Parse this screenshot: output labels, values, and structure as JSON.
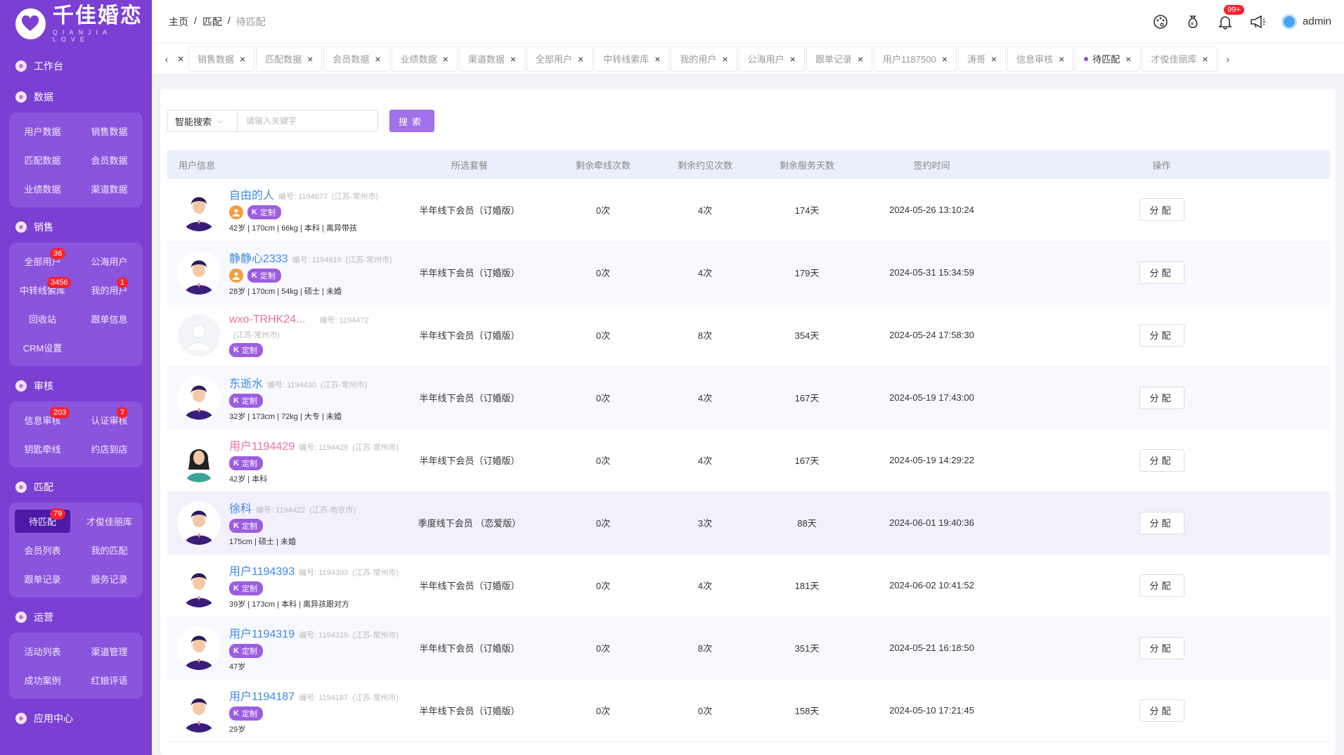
{
  "brand": {
    "title": "千佳婚恋",
    "subtitle": "QIANJIA LOVE"
  },
  "sidebar": {
    "workbench": "工作台",
    "groups": [
      {
        "label": "数据",
        "items": [
          {
            "label": "用户数据"
          },
          {
            "label": "销售数据"
          },
          {
            "label": "匹配数据"
          },
          {
            "label": "会员数据"
          },
          {
            "label": "业绩数据"
          },
          {
            "label": "渠道数据"
          }
        ]
      },
      {
        "label": "销售",
        "items": [
          {
            "label": "全部用户",
            "badge": "36"
          },
          {
            "label": "公海用户"
          },
          {
            "label": "中转线索库",
            "badge": "3456"
          },
          {
            "label": "我的用户",
            "badge": "1"
          },
          {
            "label": "回收站"
          },
          {
            "label": "跟单信息"
          },
          {
            "label": "CRM设置"
          }
        ]
      },
      {
        "label": "审核",
        "items": [
          {
            "label": "信息审核",
            "badge": "203"
          },
          {
            "label": "认证审核",
            "badge": "7"
          },
          {
            "label": "钥匙牵线"
          },
          {
            "label": "约店到店"
          }
        ]
      },
      {
        "label": "匹配",
        "items": [
          {
            "label": "待匹配",
            "badge": "79",
            "active": true
          },
          {
            "label": "才俊佳丽库"
          },
          {
            "label": "会员列表"
          },
          {
            "label": "我的匹配"
          },
          {
            "label": "跟单记录"
          },
          {
            "label": "服务记录"
          }
        ]
      },
      {
        "label": "运营",
        "items": [
          {
            "label": "活动列表"
          },
          {
            "label": "渠道管理"
          },
          {
            "label": "成功案例"
          },
          {
            "label": "红娘评语"
          }
        ]
      }
    ],
    "app_center": "应用中心"
  },
  "header": {
    "breadcrumb": [
      "主页",
      "匹配",
      "待匹配"
    ],
    "sep": "/",
    "notif_badge": "99+",
    "user": "admin"
  },
  "tabs": [
    "销售数据",
    "匹配数据",
    "会员数据",
    "业绩数据",
    "渠道数据",
    "全部用户",
    "中转线索库",
    "我的用户",
    "公海用户",
    "跟单记录",
    "用户1187500",
    "涛哥",
    "信息审核",
    "待匹配",
    "才俊佳丽库"
  ],
  "active_tab": "待匹配",
  "search": {
    "select": "智能搜索",
    "placeholder": "请输入关键字",
    "button": "搜索"
  },
  "columns": [
    "用户信息",
    "所选套餐",
    "剩余牵线次数",
    "剩余约见次数",
    "剩余服务天数",
    "签约时间",
    "操作"
  ],
  "rows": [
    {
      "name": "自由的人",
      "id": "编号: 1194677",
      "region": "(江苏-常州市)",
      "gold": true,
      "tag": "定制",
      "attrs": "42岁 | 170cm | 66kg | 本科 | 离异带孩",
      "avatar": "male",
      "package": "半年线下会员（订婚版）",
      "qx": "0次",
      "yj": "4次",
      "days": "174天",
      "time": "2024-05-26 13:10:24",
      "action": "分配"
    },
    {
      "name": "静静心2333",
      "id": "编号: 1194616",
      "region": "(江苏-常州市)",
      "gold": true,
      "tag": "定制",
      "attrs": "28岁 | 170cm | 54kg | 硕士 | 未婚",
      "avatar": "male",
      "package": "半年线下会员（订婚版）",
      "qx": "0次",
      "yj": "4次",
      "days": "179天",
      "time": "2024-05-31 15:34:59",
      "action": "分配"
    },
    {
      "name": "wxo-TRHK24...",
      "id": "编号: 1194472",
      "region": "(江苏-常州市)",
      "pink": true,
      "tag": "定制",
      "attrs": "",
      "avatar": "blank",
      "package": "半年线下会员（订婚版）",
      "qx": "0次",
      "yj": "8次",
      "days": "354天",
      "time": "2024-05-24 17:58:30",
      "action": "分配"
    },
    {
      "name": "东逝水",
      "id": "编号: 1194430",
      "region": "(江苏-常州市)",
      "tag": "定制",
      "attrs": "32岁 | 173cm | 72kg | 大专 | 未婚",
      "avatar": "male",
      "package": "半年线下会员（订婚版）",
      "qx": "0次",
      "yj": "4次",
      "days": "167天",
      "time": "2024-05-19 17:43:00",
      "action": "分配"
    },
    {
      "name": "用户1194429",
      "id": "编号: 1194429",
      "region": "(江苏-常州市)",
      "pink": true,
      "tag": "定制",
      "attrs": "42岁 | 本科",
      "avatar": "female",
      "package": "半年线下会员（订婚版）",
      "qx": "0次",
      "yj": "4次",
      "days": "167天",
      "time": "2024-05-19 14:29:22",
      "action": "分配"
    },
    {
      "name": "徐科",
      "id": "编号: 1194422",
      "region": "(江苏-南京市)",
      "tag": "定制",
      "attrs": "175cm | 硕士 | 未婚",
      "avatar": "male",
      "highlight": true,
      "package": "季度线下会员 （恋爱版）",
      "qx": "0次",
      "yj": "3次",
      "days": "88天",
      "time": "2024-06-01 19:40:36",
      "action": "分配"
    },
    {
      "name": "用户1194393",
      "id": "编号: 1194393",
      "region": "(江苏-常州市)",
      "tag": "定制",
      "attrs": "39岁 | 173cm | 本科 | 离异孩跟对方",
      "avatar": "male",
      "package": "半年线下会员（订婚版）",
      "qx": "0次",
      "yj": "4次",
      "days": "181天",
      "time": "2024-06-02 10:41:52",
      "action": "分配"
    },
    {
      "name": "用户1194319",
      "id": "编号: 1194319",
      "region": "(江苏-常州市)",
      "tag": "定制",
      "attrs": "47岁",
      "avatar": "male",
      "package": "半年线下会员（订婚版）",
      "qx": "0次",
      "yj": "8次",
      "days": "351天",
      "time": "2024-05-21 16:18:50",
      "action": "分配"
    },
    {
      "name": "用户1194187",
      "id": "编号: 1194187",
      "region": "(江苏-常州市)",
      "tag": "定制",
      "attrs": "29岁",
      "avatar": "male",
      "package": "半年线下会员（订婚版）",
      "qx": "0次",
      "yj": "0次",
      "days": "158天",
      "time": "2024-05-10 17:21:45",
      "action": "分配"
    }
  ],
  "colors": {
    "sidebar": "#7b3fd4",
    "accent": "#a270ea",
    "link": "#3d8ae6",
    "pink": "#ee6fa6",
    "badge": "#f5222d"
  }
}
